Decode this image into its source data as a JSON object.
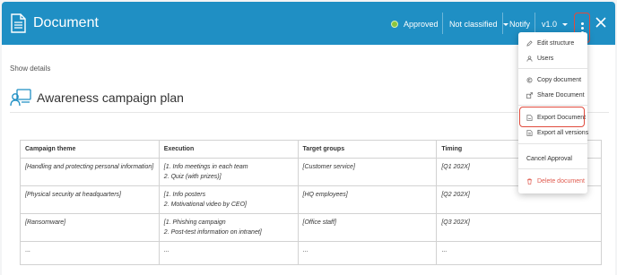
{
  "header": {
    "title": "Document",
    "status_label": "Approved",
    "classification_label": "Not classified",
    "notify_label": "Notify",
    "version_label": "v1.0"
  },
  "content": {
    "show_details": "Show details",
    "section_title": "Awareness campaign plan"
  },
  "table": {
    "headers": [
      "Campaign theme",
      "Execution",
      "Target groups",
      "Timing"
    ],
    "rows": [
      [
        "[Handling and protecting personal information]",
        "[1. Info meetings in each team",
        "2. Quiz (with prizes)]",
        "[Customer service]",
        "[Q1 202X]"
      ],
      [
        "[Physical security at headquarters]",
        "[1. Info posters",
        "2. Motivational video by CEO]",
        "[HQ employees]",
        "[Q2 202X]"
      ],
      [
        "[Ransomware]",
        "[1. Phishing campaign",
        "2. Post-test information on intranet]",
        "[Office staff]",
        "[Q3 202X]"
      ],
      [
        "...",
        "...",
        "",
        "...",
        "..."
      ]
    ]
  },
  "menu": {
    "items": [
      {
        "label": "Edit structure",
        "icon": "pencil-icon"
      },
      {
        "label": "Users",
        "icon": "user-icon"
      },
      {
        "label": "Copy document",
        "icon": "copy-icon"
      },
      {
        "label": "Share Document",
        "icon": "share-icon"
      },
      {
        "label": "Export Document",
        "icon": "export-icon"
      },
      {
        "label": "Export all versions",
        "icon": "export-all-icon"
      },
      {
        "label": "Cancel Approval",
        "icon": ""
      },
      {
        "label": "Delete document",
        "icon": "trash-icon"
      }
    ]
  },
  "colors": {
    "header_bg": "#1f8fc4",
    "status_green": "#8cc63e",
    "highlight_red": "#e04b3d",
    "danger_text": "#e05a4e"
  }
}
